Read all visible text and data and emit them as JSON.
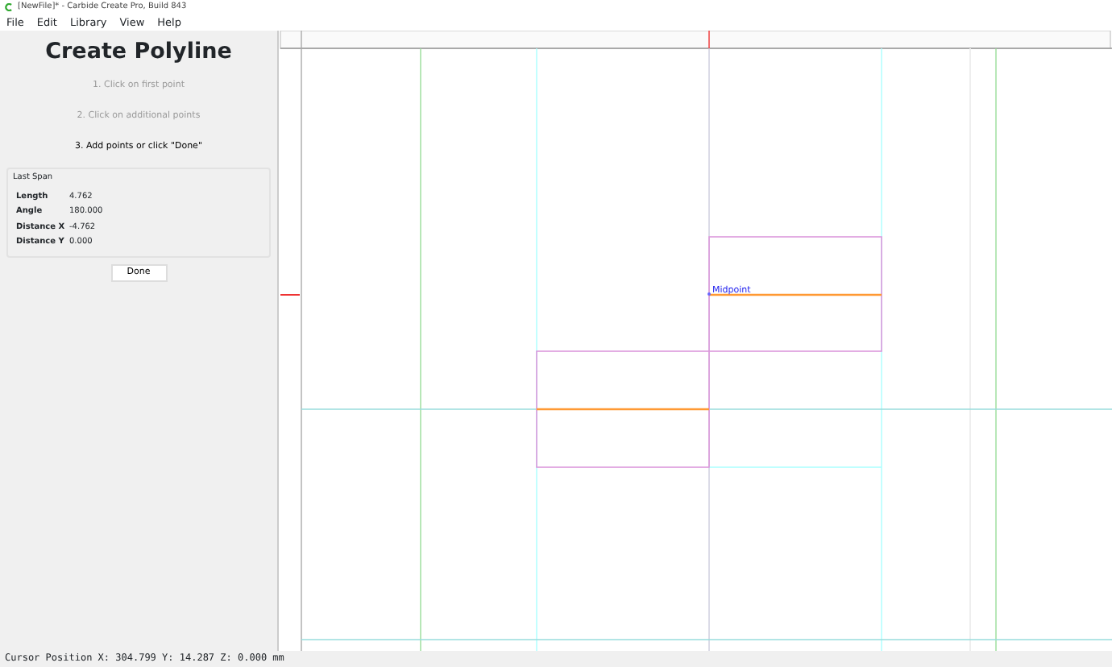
{
  "window": {
    "title": "[NewFile]* - Carbide Create Pro, Build 843"
  },
  "menu": [
    {
      "label": "File"
    },
    {
      "label": "Edit"
    },
    {
      "label": "Library"
    },
    {
      "label": "View"
    },
    {
      "label": "Help"
    }
  ],
  "panel": {
    "title": "Create Polyline",
    "steps": [
      {
        "text": "1. Click on first point",
        "current": false
      },
      {
        "text": "2. Click on additional points",
        "current": false
      },
      {
        "text": "3. Add points or click \"Done\"",
        "current": true
      }
    ],
    "last_span": {
      "title": "Last Span",
      "rows": [
        {
          "label": "Length",
          "value": "4.762"
        },
        {
          "label": "Angle",
          "value": "180.000"
        },
        {
          "label": "Distance X",
          "value": "-4.762"
        },
        {
          "label": "Distance Y",
          "value": "0.000"
        }
      ]
    },
    "done_button": "Done"
  },
  "canvas": {
    "point_label": "Midpoint"
  },
  "status_bar": "Cursor Position X: 304.799 Y: 14.287 Z: 0.000 mm"
}
